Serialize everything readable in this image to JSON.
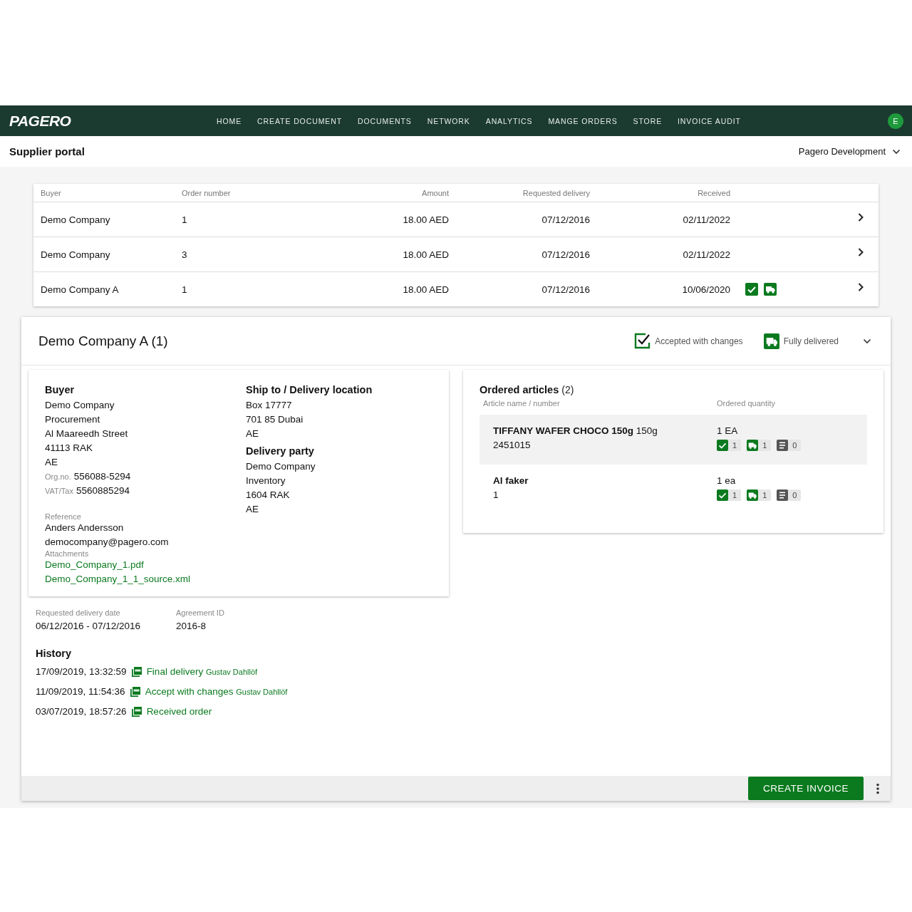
{
  "nav": {
    "logo": "PAGERO",
    "items": [
      {
        "label": "HOME"
      },
      {
        "label": "CREATE DOCUMENT"
      },
      {
        "label": "DOCUMENTS"
      },
      {
        "label": "NETWORK"
      },
      {
        "label": "ANALYTICS"
      },
      {
        "label": "MANGE ORDERS"
      },
      {
        "label": "STORE"
      },
      {
        "label": "INVOICE AUDIT"
      }
    ],
    "avatar": "E"
  },
  "subheader": {
    "title": "Supplier portal",
    "account": "Pagero Development"
  },
  "orders": {
    "columns": [
      "Buyer",
      "Order number",
      "Amount",
      "Requested delivery",
      "Received"
    ],
    "rows": [
      {
        "buyer": "Demo Company",
        "order_number": "1",
        "amount": "18.00 AED",
        "requested_delivery": "07/12/2016",
        "received": "02/11/2022",
        "accepted": false,
        "delivered": false
      },
      {
        "buyer": "Demo Company",
        "order_number": "3",
        "amount": "18.00 AED",
        "requested_delivery": "07/12/2016",
        "received": "02/11/2022",
        "accepted": false,
        "delivered": false
      },
      {
        "buyer": "Demo Company A",
        "order_number": "1",
        "amount": "18.00 AED",
        "requested_delivery": "07/12/2016",
        "received": "10/06/2020",
        "accepted": true,
        "delivered": true
      }
    ]
  },
  "detail": {
    "title": "Demo Company A (1)",
    "statuses": [
      {
        "kind": "accepted",
        "label": "Accepted with changes"
      },
      {
        "kind": "delivered",
        "label": "Fully delivered"
      }
    ],
    "buyer": {
      "heading": "Buyer",
      "lines": [
        "Demo Company",
        "Procurement",
        "Al Maareedh Street",
        "41113 RAK",
        "AE"
      ],
      "org_label": "Org.no.",
      "org": "556088-5294",
      "vat_label": "VAT/Tax",
      "vat": "5560885294",
      "reference_label": "Reference",
      "reference": [
        "Anders Andersson",
        "democompany@pagero.com"
      ],
      "attachments_label": "Attachments",
      "attachments": [
        "Demo_Company_1.pdf",
        "Demo_Company_1_1_source.xml"
      ]
    },
    "ship_to": {
      "heading": "Ship to / Delivery location",
      "lines": [
        "Box 17777",
        "701 85 Dubai",
        "AE"
      ]
    },
    "delivery_party": {
      "heading": "Delivery party",
      "lines": [
        "Demo Company",
        "Inventory",
        "1604 RAK",
        "AE"
      ]
    },
    "articles": {
      "heading": "Ordered articles",
      "count": "(2)",
      "columns": [
        "Article name / number",
        "Ordered quantity"
      ],
      "items": [
        {
          "name": "TIFFANY WAFER CHOCO 150g",
          "suffix": "150g",
          "number": "2451015",
          "quantity": "1 EA",
          "accepted": "1",
          "delivered": "1",
          "invoiced": "0",
          "selected": true
        },
        {
          "name": "Al faker",
          "number": "1",
          "quantity": "1 ea",
          "accepted": "1",
          "delivered": "1",
          "invoiced": "0",
          "selected": false
        }
      ]
    },
    "requested_delivery_date": {
      "label": "Requested delivery date",
      "value": "06/12/2016 - 07/12/2016"
    },
    "agreement_id": {
      "label": "Agreement ID",
      "value": "2016-8"
    },
    "history": {
      "heading": "History",
      "entries": [
        {
          "time": "17/09/2019, 13:32:59",
          "action": "Final delivery",
          "user": "Gustav Dahllöf"
        },
        {
          "time": "11/09/2019, 11:54:36",
          "action": "Accept with changes",
          "user": "Gustav Dahllöf"
        },
        {
          "time": "03/07/2019, 18:57:26",
          "action": "Received order"
        }
      ]
    },
    "footer": {
      "button": "CREATE INVOICE"
    }
  }
}
